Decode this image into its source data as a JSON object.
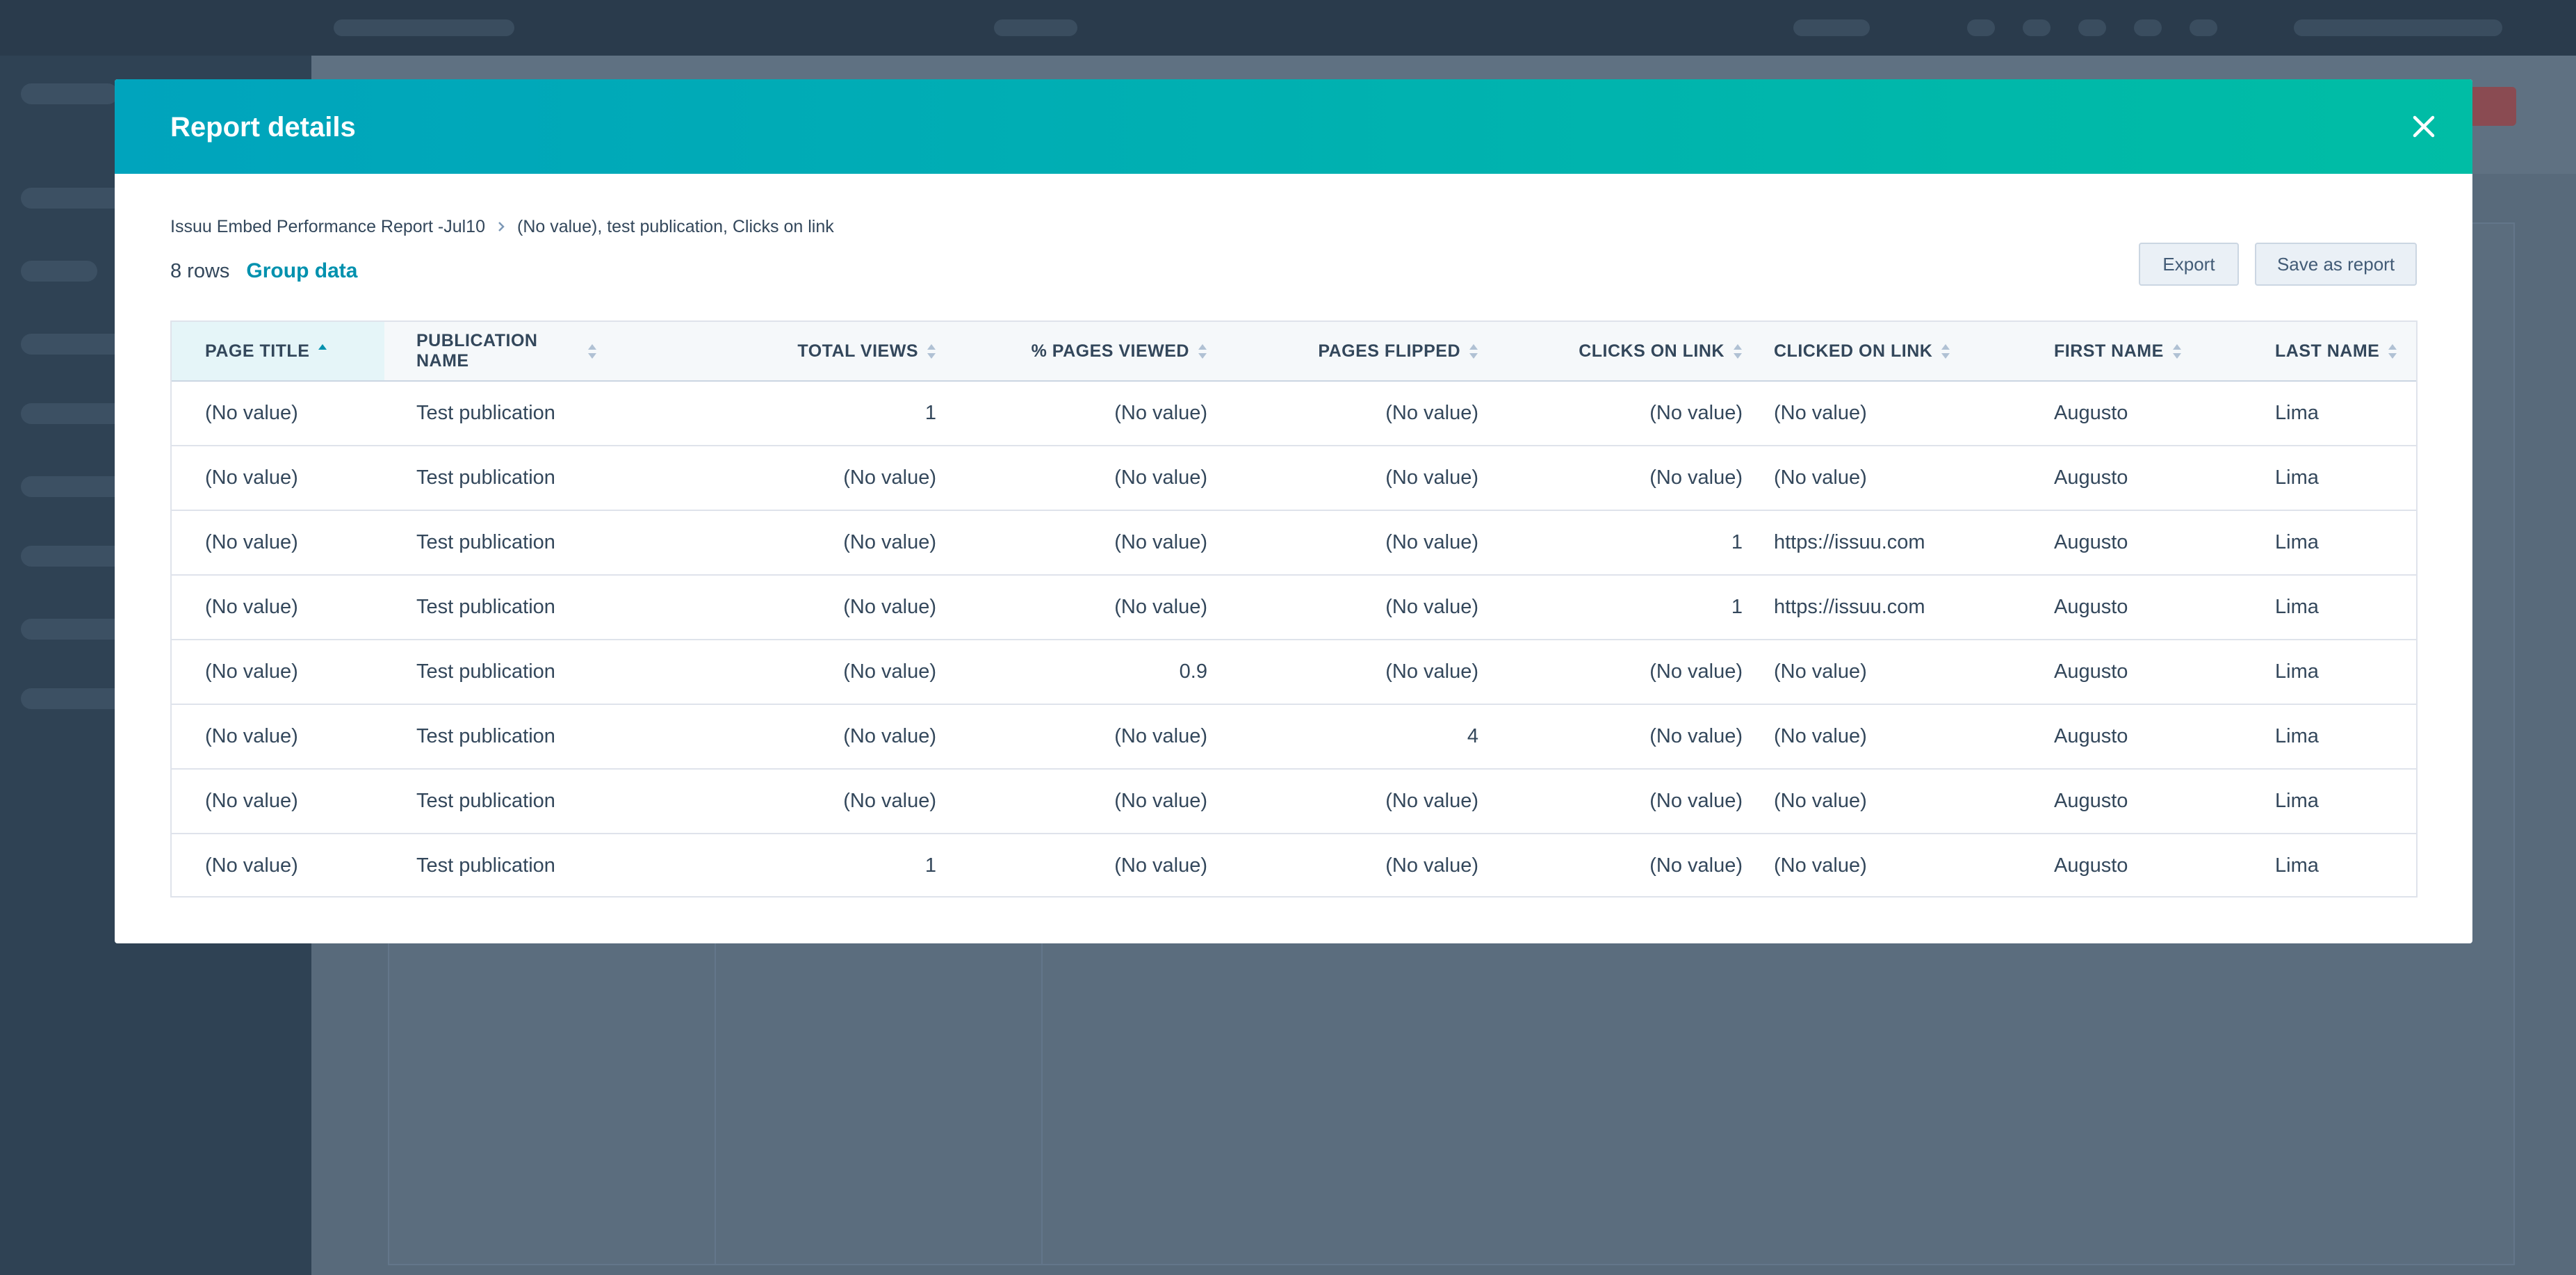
{
  "modal": {
    "title": "Report details",
    "close_icon": "close-icon"
  },
  "breadcrumb": {
    "parent": "Issuu Embed Performance Report -Jul10",
    "current": "(No value), test publication, Clicks on link"
  },
  "summary": {
    "rows_count": "8 rows",
    "group_data": "Group data"
  },
  "actions": {
    "export": "Export",
    "save_as_report": "Save as report"
  },
  "table": {
    "columns": [
      {
        "label": "PAGE TITLE",
        "sort": "ascending"
      },
      {
        "label": "PUBLICATION NAME",
        "sort": "none"
      },
      {
        "label": "TOTAL VIEWS",
        "sort": "none"
      },
      {
        "label": "% PAGES VIEWED",
        "sort": "none"
      },
      {
        "label": "PAGES FLIPPED",
        "sort": "none"
      },
      {
        "label": "CLICKS ON LINK",
        "sort": "none"
      },
      {
        "label": "CLICKED ON LINK",
        "sort": "none"
      },
      {
        "label": "FIRST NAME",
        "sort": "none"
      },
      {
        "label": "LAST NAME",
        "sort": "none"
      }
    ],
    "rows": [
      [
        "(No value)",
        "Test publication",
        "1",
        "(No value)",
        "(No value)",
        "(No value)",
        "(No value)",
        "Augusto",
        "Lima"
      ],
      [
        "(No value)",
        "Test publication",
        "(No value)",
        "(No value)",
        "(No value)",
        "(No value)",
        "(No value)",
        "Augusto",
        "Lima"
      ],
      [
        "(No value)",
        "Test publication",
        "(No value)",
        "(No value)",
        "(No value)",
        "1",
        "https://issuu.com",
        "Augusto",
        "Lima"
      ],
      [
        "(No value)",
        "Test publication",
        "(No value)",
        "(No value)",
        "(No value)",
        "1",
        "https://issuu.com",
        "Augusto",
        "Lima"
      ],
      [
        "(No value)",
        "Test publication",
        "(No value)",
        "0.9",
        "(No value)",
        "(No value)",
        "(No value)",
        "Augusto",
        "Lima"
      ],
      [
        "(No value)",
        "Test publication",
        "(No value)",
        "(No value)",
        "4",
        "(No value)",
        "(No value)",
        "Augusto",
        "Lima"
      ],
      [
        "(No value)",
        "Test publication",
        "(No value)",
        "(No value)",
        "(No value)",
        "(No value)",
        "(No value)",
        "Augusto",
        "Lima"
      ],
      [
        "(No value)",
        "Test publication",
        "1",
        "(No value)",
        "(No value)",
        "(No value)",
        "(No value)",
        "Augusto",
        "Lima"
      ]
    ]
  },
  "colors": {
    "header_gradient_start": "#00a4bd",
    "header_gradient_end": "#00bda5",
    "link": "#0091ae",
    "text": "#33475b",
    "overlay_bg": "#33475b"
  }
}
